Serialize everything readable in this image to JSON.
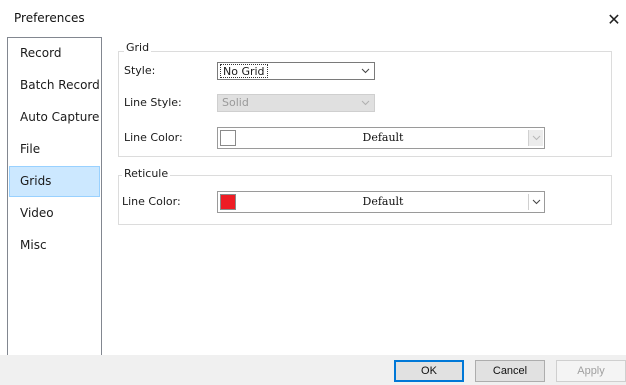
{
  "window": {
    "title": "Preferences",
    "close_glyph": "✕"
  },
  "sidebar": {
    "items": [
      {
        "label": "Record",
        "selected": false
      },
      {
        "label": "Batch Record",
        "selected": false
      },
      {
        "label": "Auto Capture",
        "selected": false
      },
      {
        "label": "File",
        "selected": false
      },
      {
        "label": "Grids",
        "selected": true
      },
      {
        "label": "Video",
        "selected": false
      },
      {
        "label": "Misc",
        "selected": false
      }
    ]
  },
  "grid": {
    "group_title": "Grid",
    "style_label": "Style:",
    "style_value": "No Grid",
    "line_style_label": "Line Style:",
    "line_style_value": "Solid",
    "line_style_enabled": false,
    "line_color_label": "Line Color:",
    "line_color_value": "Default",
    "line_color_swatch": "#ffffff",
    "line_color_enabled": false
  },
  "reticule": {
    "group_title": "Reticule",
    "line_color_label": "Line Color:",
    "line_color_value": "Default",
    "line_color_swatch": "#ee1c24"
  },
  "buttons": {
    "ok": "OK",
    "cancel": "Cancel",
    "apply": "Apply",
    "apply_enabled": false
  },
  "icons": {
    "dropdown": "chevron-down-icon",
    "close": "close-icon"
  }
}
